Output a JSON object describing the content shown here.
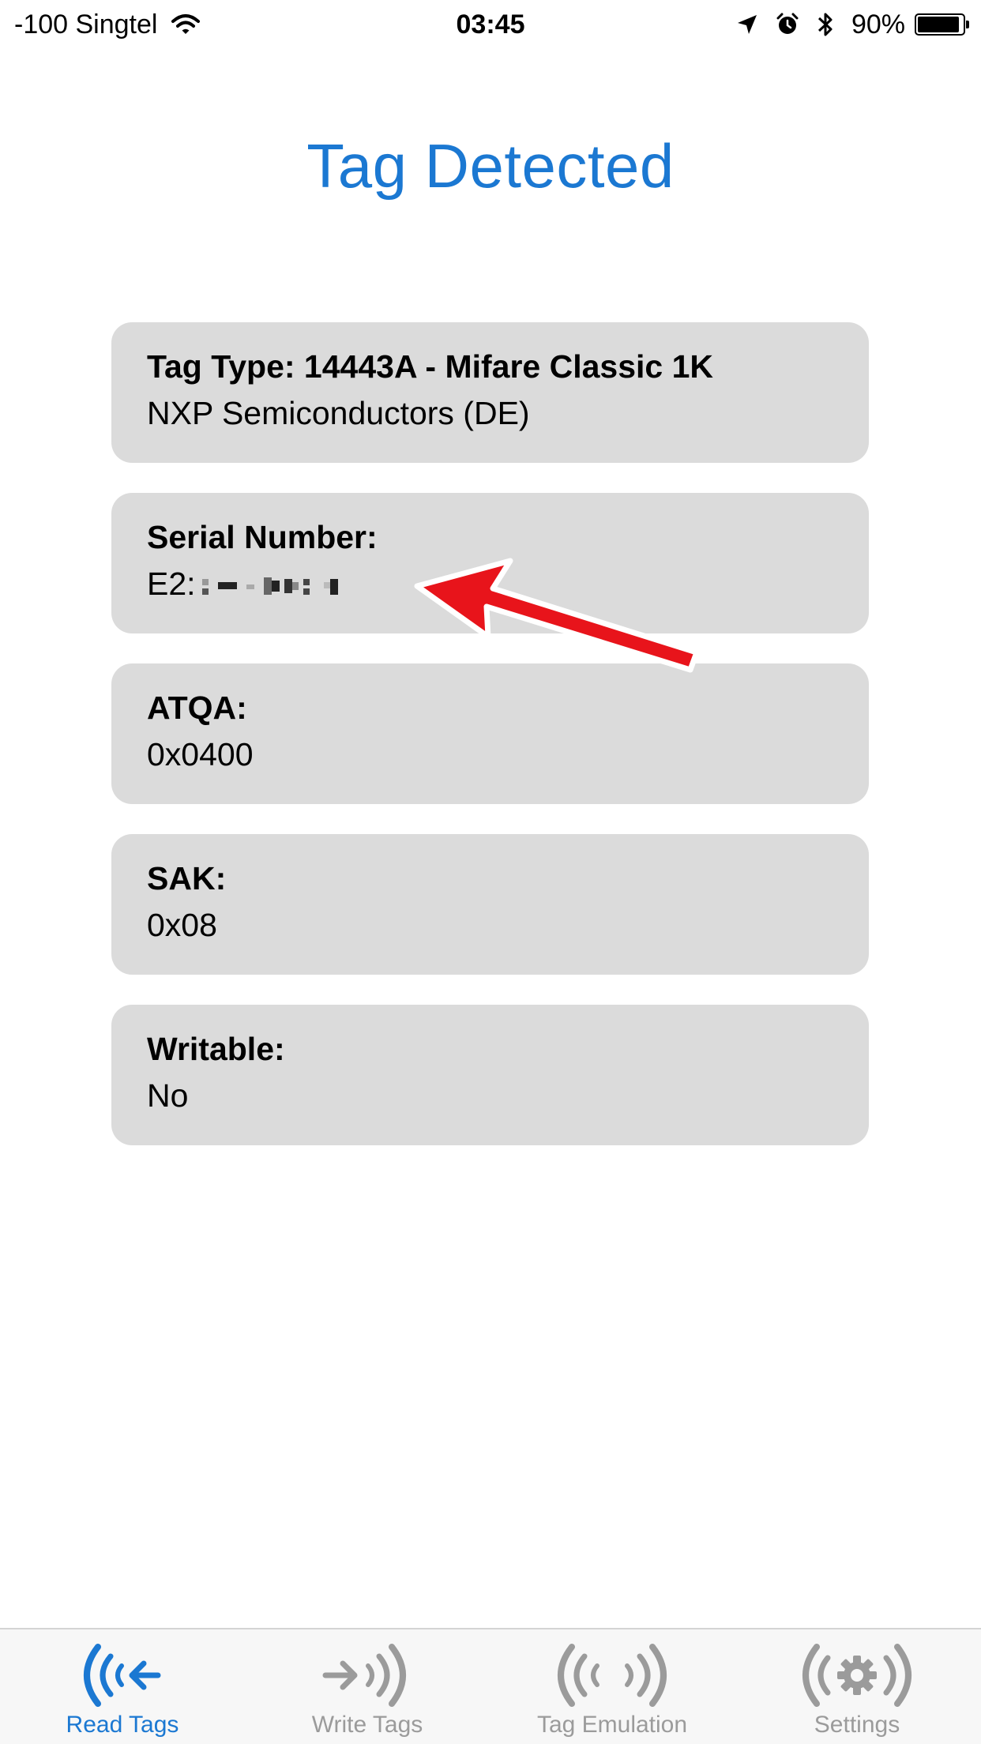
{
  "status_bar": {
    "carrier": "-100 Singtel",
    "time": "03:45",
    "battery": "90%",
    "icons": [
      "wifi-icon",
      "location-arrow-icon",
      "alarm-icon",
      "bluetooth-icon",
      "battery-icon"
    ]
  },
  "page": {
    "title": "Tag Detected",
    "accent_color": "#1b78d2"
  },
  "cards": {
    "tag_type": {
      "label": "Tag Type: 14443A - Mifare Classic 1K",
      "value": "NXP Semiconductors (DE)"
    },
    "serial": {
      "label": "Serial Number:",
      "value_prefix": "E2:"
    },
    "atqa": {
      "label": "ATQA:",
      "value": "0x0400"
    },
    "sak": {
      "label": "SAK:",
      "value": "0x08"
    },
    "writable": {
      "label": "Writable:",
      "value": "No"
    }
  },
  "annotation": {
    "color": "#e8141b",
    "icon": "red-arrow-annotation"
  },
  "tab_bar": {
    "tabs": [
      {
        "label": "Read Tags",
        "icon": "read-tags-icon",
        "active": true
      },
      {
        "label": "Write Tags",
        "icon": "write-tags-icon",
        "active": false
      },
      {
        "label": "Tag Emulation",
        "icon": "tag-emulation-icon",
        "active": false
      },
      {
        "label": "Settings",
        "icon": "settings-icon",
        "active": false
      }
    ]
  }
}
